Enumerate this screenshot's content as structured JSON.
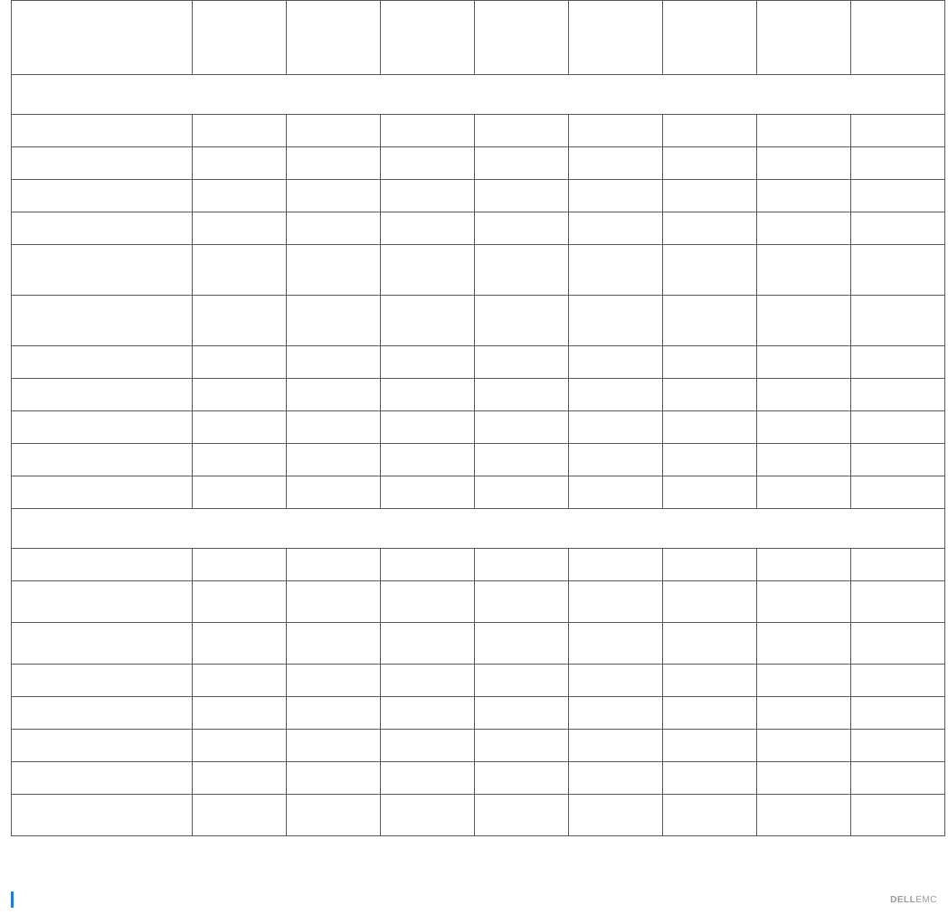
{
  "footer": {
    "page_number": "",
    "doc_title": "",
    "brand_primary": "DELL",
    "brand_secondary": "EMC"
  },
  "table": {
    "header": [
      "",
      "",
      "",
      "",
      "",
      "",
      "",
      "",
      ""
    ],
    "sections": [
      {
        "title": "",
        "rows": [
          {
            "label": "",
            "cells": [
              "",
              "",
              "",
              "",
              "",
              "",
              "",
              ""
            ],
            "style": "row"
          },
          {
            "label": "",
            "cells": [
              "",
              "",
              "",
              "",
              "",
              "",
              "",
              ""
            ],
            "style": "row"
          },
          {
            "label": "",
            "cells": [
              "",
              "",
              "",
              "",
              "",
              "",
              "",
              ""
            ],
            "style": "row"
          },
          {
            "label": "",
            "cells": [
              "",
              "",
              "",
              "",
              "",
              "",
              "",
              ""
            ],
            "style": "row"
          },
          {
            "label": "",
            "cells": [
              "",
              "",
              "",
              "",
              "",
              "",
              "",
              ""
            ],
            "style": "row tall"
          },
          {
            "label": "",
            "cells": [
              "",
              "",
              "",
              "",
              "",
              "",
              "",
              ""
            ],
            "style": "row tall"
          },
          {
            "label": "",
            "cells": [
              "",
              "",
              "",
              "",
              "",
              "",
              "",
              ""
            ],
            "style": "row"
          },
          {
            "label": "",
            "cells": [
              "",
              "",
              "",
              "",
              "",
              "",
              "",
              ""
            ],
            "style": "row"
          },
          {
            "label": "",
            "cells": [
              "",
              "",
              "",
              "",
              "",
              "",
              "",
              ""
            ],
            "style": "row"
          },
          {
            "label": "",
            "cells": [
              "",
              "",
              "",
              "",
              "",
              "",
              "",
              ""
            ],
            "style": "row"
          },
          {
            "label": "",
            "cells": [
              "",
              "",
              "",
              "",
              "",
              "",
              "",
              ""
            ],
            "style": "row"
          }
        ]
      },
      {
        "title": "",
        "rows": [
          {
            "label": "",
            "cells": [
              "",
              "",
              "",
              "",
              "",
              "",
              "",
              ""
            ],
            "style": "row"
          },
          {
            "label": "",
            "cells": [
              "",
              "",
              "",
              "",
              "",
              "",
              "",
              ""
            ],
            "style": "row med"
          },
          {
            "label": "",
            "cells": [
              "",
              "",
              "",
              "",
              "",
              "",
              "",
              ""
            ],
            "style": "row med"
          },
          {
            "label": "",
            "cells": [
              "",
              "",
              "",
              "",
              "",
              "",
              "",
              ""
            ],
            "style": "row"
          },
          {
            "label": "",
            "cells": [
              "",
              "",
              "",
              "",
              "",
              "",
              "",
              ""
            ],
            "style": "row"
          },
          {
            "label": "",
            "cells": [
              "",
              "",
              "",
              "",
              "",
              "",
              "",
              ""
            ],
            "style": "row"
          },
          {
            "label": "",
            "cells": [
              "",
              "",
              "",
              "",
              "",
              "",
              "",
              ""
            ],
            "style": "row"
          },
          {
            "label": "",
            "cells": [
              "",
              "",
              "",
              "",
              "",
              "",
              "",
              ""
            ],
            "style": "row med"
          }
        ]
      }
    ]
  }
}
